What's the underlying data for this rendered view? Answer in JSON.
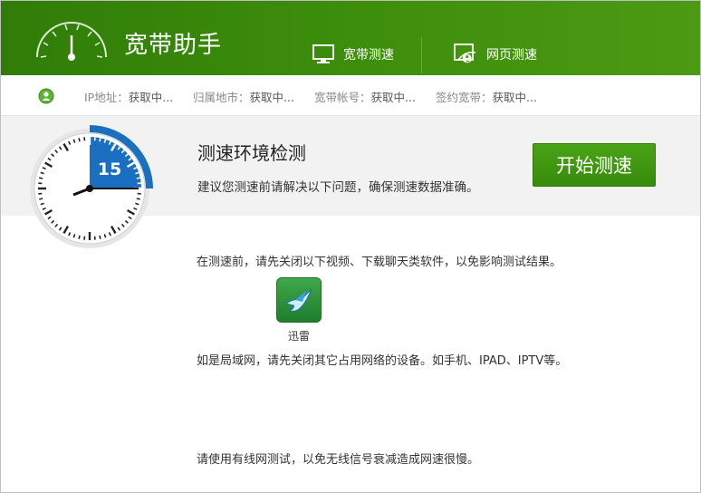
{
  "app": {
    "title": "宽带助手"
  },
  "nav": {
    "broadband_test": "宽带测速",
    "web_test": "网页测速"
  },
  "info": {
    "ip_label": "IP地址：",
    "ip_value": "获取中...",
    "city_label": "归属地市：",
    "city_value": "获取中...",
    "account_label": "宽带帐号：",
    "account_value": "获取中...",
    "contract_label": "签约宽带：",
    "contract_value": "获取中..."
  },
  "banner": {
    "title": "测速环境检测",
    "subtitle": "建议您测速前请解决以下问题，确保测速数据准确。",
    "start_button": "开始测速",
    "countdown": "15"
  },
  "content": {
    "close_software_tip": "在测速前，请先关闭以下视频、下载聊天类软件，以免影响测试结果。",
    "app_name": "迅雷",
    "lan_tip": "如是局域网，请先关闭其它占用网络的设备。如手机、IPAD、IPTV等。",
    "wired_tip": "请使用有线网测试，以免无线信号衰减造成网速很慢。"
  },
  "colors": {
    "brand_green": "#3a8a0b",
    "accent_blue": "#1a6fc0"
  }
}
